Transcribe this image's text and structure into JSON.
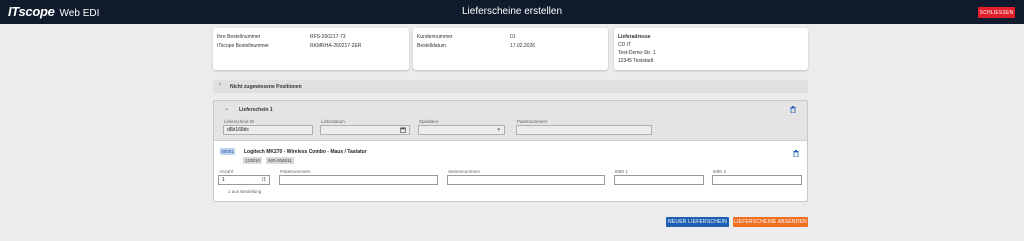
{
  "header": {
    "logo_brand": "ITscope",
    "logo_app": "Web EDI",
    "title": "Lieferscheine erstellen",
    "close_label": "SCHLIESSEN"
  },
  "order_info": {
    "rows": [
      {
        "label": "Ihre Bestellnummer",
        "value": "RFS-260217-73"
      },
      {
        "label": "ITscope Bestellnummer",
        "value": "RKMRHA-260217-2ER"
      }
    ]
  },
  "customer_info": {
    "rows": [
      {
        "label": "Kundennummer",
        "value": "01"
      },
      {
        "label": "Bestelldatum",
        "value": "17.02.2026"
      }
    ]
  },
  "address": {
    "heading": "Lieferadresse",
    "lines": [
      "CD IT",
      "Test-Demo-Str. 1",
      "12345 Teststadt"
    ]
  },
  "unassigned": {
    "label": "Nicht zugewiesene Positionen"
  },
  "delivery_note": {
    "title": "Lieferschein 1",
    "fields": {
      "id_label": "Lieferschein-ID",
      "id_value": "d6b168dc",
      "date_label": "Lieferdatum",
      "carrier_label": "Spediteur",
      "package_label": "Paketnummern"
    }
  },
  "position": {
    "number": "00001",
    "name": "Logitech MK270 - Wireless Combo - Maus / Tastatur",
    "chips": [
      "123010",
      "920-004511"
    ],
    "fields": {
      "qty_label": "Anzahl",
      "qty_value": "1",
      "qty_max": "/1",
      "qty_hint": "1 aus Bestellung",
      "package_label": "Paketnummern",
      "serial_label": "Seriennummern",
      "imei1_label": "IMEI 1",
      "imei2_label": "IMEI 2"
    }
  },
  "actions": {
    "new_label": "NEUER LIEFERSCHEIN",
    "send_label": "LIEFERSCHEINE ABSENDEN"
  },
  "colors": {
    "topbar": "#0f1a2c",
    "close": "#e0202a",
    "primary": "#1f5fb3",
    "accent": "#f07023"
  },
  "icons": [
    "trash-icon",
    "calendar-icon",
    "chevron-down-icon",
    "chevron-right-icon"
  ]
}
